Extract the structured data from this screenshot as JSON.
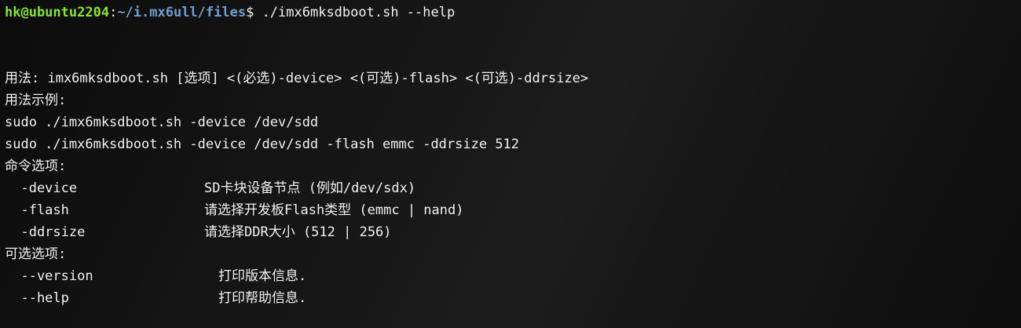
{
  "prompt": {
    "user_host": "hk@ubuntu2204",
    "colon": ":",
    "path": "~/i.mx6ull/files",
    "symbol": "$",
    "command": " ./imx6mksdboot.sh --help"
  },
  "output": {
    "usage": "用法: imx6mksdboot.sh [选项] <(必选)-device> <(可选)-flash> <(可选)-ddrsize>",
    "example_header": "用法示例:",
    "example_1": "sudo ./imx6mksdboot.sh -device /dev/sdd",
    "example_2": "sudo ./imx6mksdboot.sh -device /dev/sdd -flash emmc -ddrsize 512",
    "required_header": "命令选项:",
    "required_options": [
      {
        "name": "  -device",
        "desc": "SD卡块设备节点 (例如/dev/sdx)"
      },
      {
        "name": "  -flash",
        "desc": "请选择开发板Flash类型 (emmc | nand)"
      },
      {
        "name": "  -ddrsize",
        "desc": "请选择DDR大小 (512 | 256)"
      }
    ],
    "optional_header": "可选选项:",
    "optional_options": [
      {
        "name": "  --version",
        "desc": "打印版本信息."
      },
      {
        "name": "  --help",
        "desc": "打印帮助信息."
      }
    ]
  }
}
